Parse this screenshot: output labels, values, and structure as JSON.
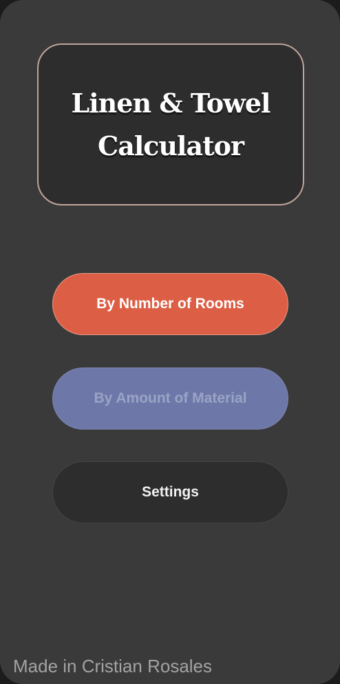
{
  "app": {
    "title_line1": "Linen & Towel",
    "title_line2": "Calculator"
  },
  "menu": {
    "rooms_label": "By Number of Rooms",
    "material_label": "By Amount of Material",
    "settings_label": "Settings"
  },
  "footer": {
    "credit": "Made in Cristian Rosales"
  },
  "colors": {
    "background": "#3a3a3a",
    "card": "#2d2d2d",
    "card_border": "#c2a49d",
    "rooms_button": "#dc5f45",
    "material_button": "#6e78a8",
    "settings_button": "#2d2d2d"
  }
}
